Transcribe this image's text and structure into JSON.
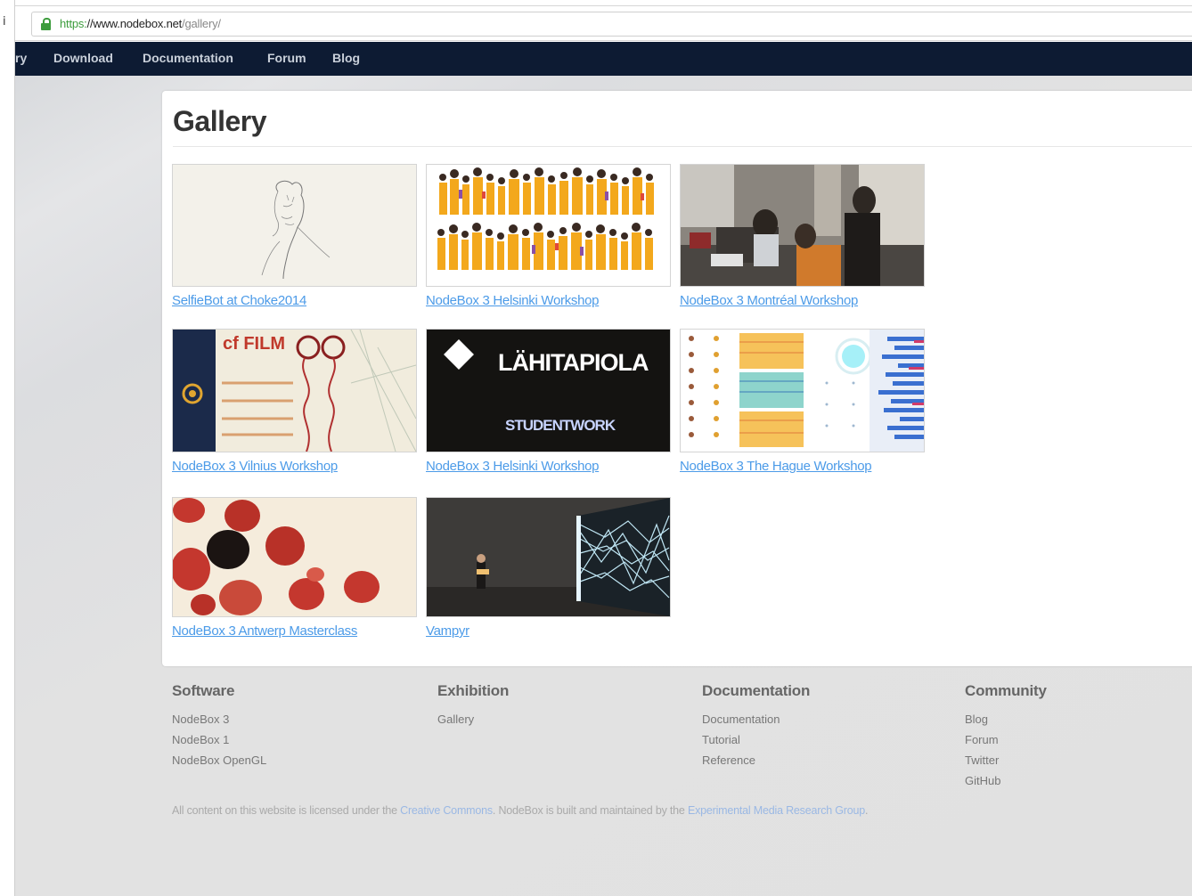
{
  "browser": {
    "partial_icon_glyph": "i",
    "url_scheme": "https:",
    "url_host": "//www.nodebox.net",
    "url_path": "/gallery/"
  },
  "nav": {
    "items": [
      "ry",
      "Download",
      "Documentation",
      "Forum",
      "Blog"
    ]
  },
  "page": {
    "title": "Gallery"
  },
  "gallery": {
    "items": [
      {
        "caption": "SelfieBot at Choke2014"
      },
      {
        "caption": "NodeBox 3 Helsinki Workshop"
      },
      {
        "caption": "NodeBox 3 Montréal Workshop"
      },
      {
        "caption": "NodeBox 3 Vilnius Workshop",
        "thumb_text": "cf FILM"
      },
      {
        "caption": "NodeBox 3 Helsinki Workshop",
        "thumb_text_1": "LÄHITAPIOLA",
        "thumb_text_2": "STUDENTWORK"
      },
      {
        "caption": "NodeBox 3 The Hague Workshop"
      },
      {
        "caption": "NodeBox 3 Antwerp Masterclass"
      },
      {
        "caption": "Vampyr"
      }
    ]
  },
  "footer": {
    "columns": [
      {
        "heading": "Software",
        "links": [
          "NodeBox 3",
          "NodeBox 1",
          "NodeBox OpenGL"
        ]
      },
      {
        "heading": "Exhibition",
        "links": [
          "Gallery"
        ]
      },
      {
        "heading": "Documentation",
        "links": [
          "Documentation",
          "Tutorial",
          "Reference"
        ]
      },
      {
        "heading": "Community",
        "links": [
          "Blog",
          "Forum",
          "Twitter",
          "GitHub"
        ]
      }
    ],
    "license": {
      "prefix": "All content on this website is licensed under the ",
      "link1": "Creative Commons",
      "middle": ". NodeBox is built and maintained by the ",
      "link2": "Experimental Media Research Group",
      "suffix": "."
    }
  },
  "colors": {
    "nav_bg": "#0d1b33",
    "link": "#4c9be8",
    "lock": "#3c9c3c"
  }
}
